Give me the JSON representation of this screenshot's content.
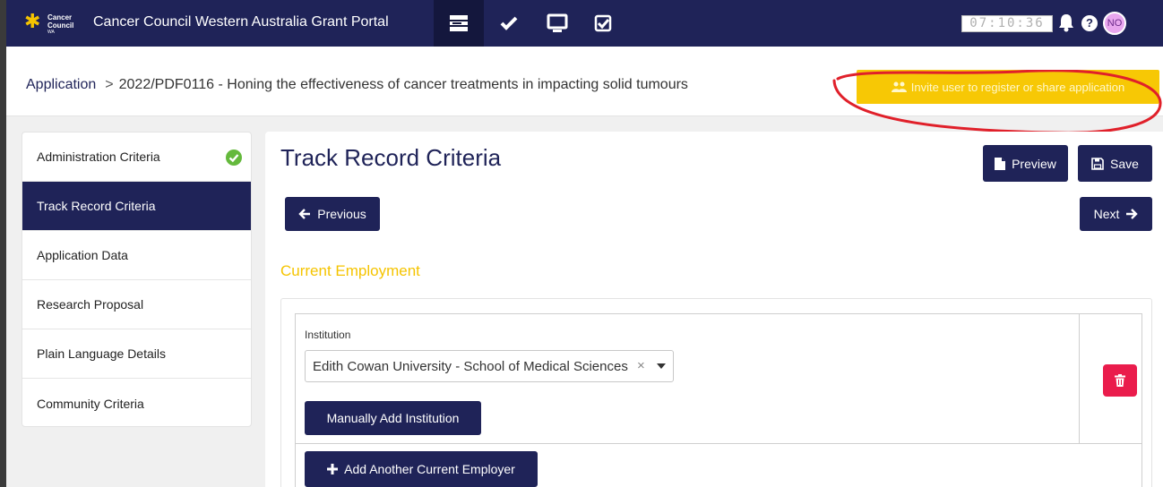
{
  "header": {
    "logo_text_line1": "Cancer",
    "logo_text_line2": "Council",
    "logo_sub": "WA",
    "title": "Cancer Council Western Australia Grant Portal",
    "clock": "07:10:36",
    "user_initials": "NO",
    "nav_icons": [
      "list-icon",
      "check-icon",
      "monitor-icon",
      "checkbox-icon"
    ]
  },
  "breadcrumb": {
    "root": "Application",
    "separator": ">",
    "current": "2022/PDF0116 - Honing the effectiveness of cancer treatments in impacting solid tumours"
  },
  "invite_button_label": "Invite user to register or share application",
  "sidebar": {
    "items": [
      {
        "label": "Administration Criteria",
        "complete": true
      },
      {
        "label": "Track Record Criteria",
        "active": true
      },
      {
        "label": "Application Data"
      },
      {
        "label": "Research Proposal"
      },
      {
        "label": "Plain Language Details"
      },
      {
        "label": "Community Criteria"
      }
    ]
  },
  "main": {
    "title": "Track Record Criteria",
    "preview_label": "Preview",
    "save_label": "Save",
    "previous_label": "Previous",
    "next_label": "Next",
    "section_title": "Current Employment",
    "institution_label": "Institution",
    "institution_value": "Edith Cowan University - School of Medical Sciences",
    "clear_symbol": "×",
    "manual_add_label": "Manually Add Institution",
    "add_employer_label": "Add Another Current Employer"
  },
  "colors": {
    "navy": "#1f2358",
    "accent_yellow": "#f7c805",
    "success_green": "#64b93c",
    "danger_red": "#ea1c4c",
    "annotation_red": "#e0202a"
  }
}
